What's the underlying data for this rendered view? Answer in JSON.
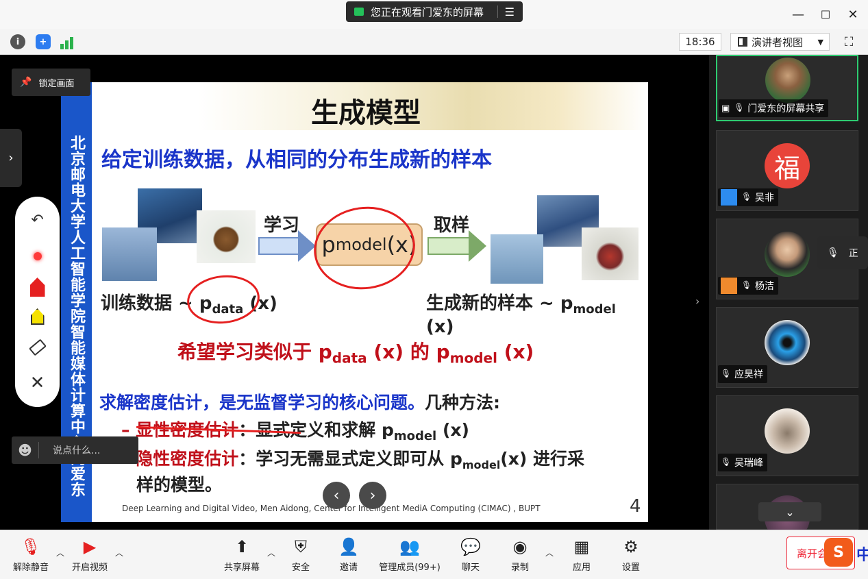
{
  "banner": {
    "text": "您正在观看门爱东的屏幕",
    "menu_icon": "menu-icon"
  },
  "window_controls": {
    "minimize": "—",
    "maximize": "☐",
    "close": "✕"
  },
  "toolbar": {
    "clock": "18:36",
    "view_mode": "演讲者视图",
    "info_icon": "info-icon",
    "shield_icon": "shield-icon",
    "signal_icon": "signal-icon"
  },
  "main": {
    "lock_label": "锁定画面",
    "chat_placeholder": "说点什么...",
    "slide": {
      "vertical_bar": "北京邮电大学人工智能学院智能媒体计算中心门爱东",
      "title": "生成模型",
      "subtitle": "给定训练数据，从相同的分布生成新的样本",
      "learn_label": "学习",
      "sample_label": "取样",
      "pmodel": "p",
      "pmodel_sub": "model",
      "pmodel_x": " (x)",
      "train_label": "训练数据 ~ p",
      "train_sub": "data",
      "train_x": " (x)",
      "gen_label": "生成新的样本 ~ p",
      "gen_sub": "model",
      "gen_x": " (x)",
      "hope_a": "希望学习类似于 p",
      "hope_sub1": "data",
      "hope_b": " (x) 的 p",
      "hope_sub2": "model",
      "hope_c": " (x)",
      "density_blue": "求解密度估计，是无监督学习的核心问题。",
      "density_black": "几种方法:",
      "b1_dash": "–",
      "b1_red": "显性密度估计",
      "b1_black": "：显式定义和求解 p",
      "b1_sub": "model",
      "b1_x": " (x)",
      "b2_dash": "–",
      "b2_red": "隐性密度估计",
      "b2_black": "：学习无需显式定义即可从 p",
      "b2_sub": "model",
      "b2_x": "(x) 进行采",
      "b2_line2": "样的模型。",
      "footer": "Deep Learning and Digital Video, Men Aidong, Center for Intelligent MediA Computing (CIMAC) , BUPT",
      "page": "4"
    },
    "annotation_tools": [
      "undo-icon",
      "laser-pointer-icon",
      "pen-icon",
      "highlighter-icon",
      "eraser-icon",
      "close-icon"
    ]
  },
  "participants": [
    {
      "name": "门爱东的屏幕共享",
      "active": true
    },
    {
      "name": "吴非"
    },
    {
      "name": "杨洁"
    },
    {
      "name": "应昊祥"
    },
    {
      "name": "吴瑞峰"
    }
  ],
  "floating_label": "正",
  "bottom": {
    "unmute": "解除静音",
    "start_video": "开启视频",
    "share_screen": "共享屏幕",
    "security": "安全",
    "invite": "邀请",
    "manage": "管理成员(99+)",
    "chat": "聊天",
    "record": "录制",
    "apps": "应用",
    "settings": "设置",
    "leave": "离开会",
    "ime": "中"
  }
}
